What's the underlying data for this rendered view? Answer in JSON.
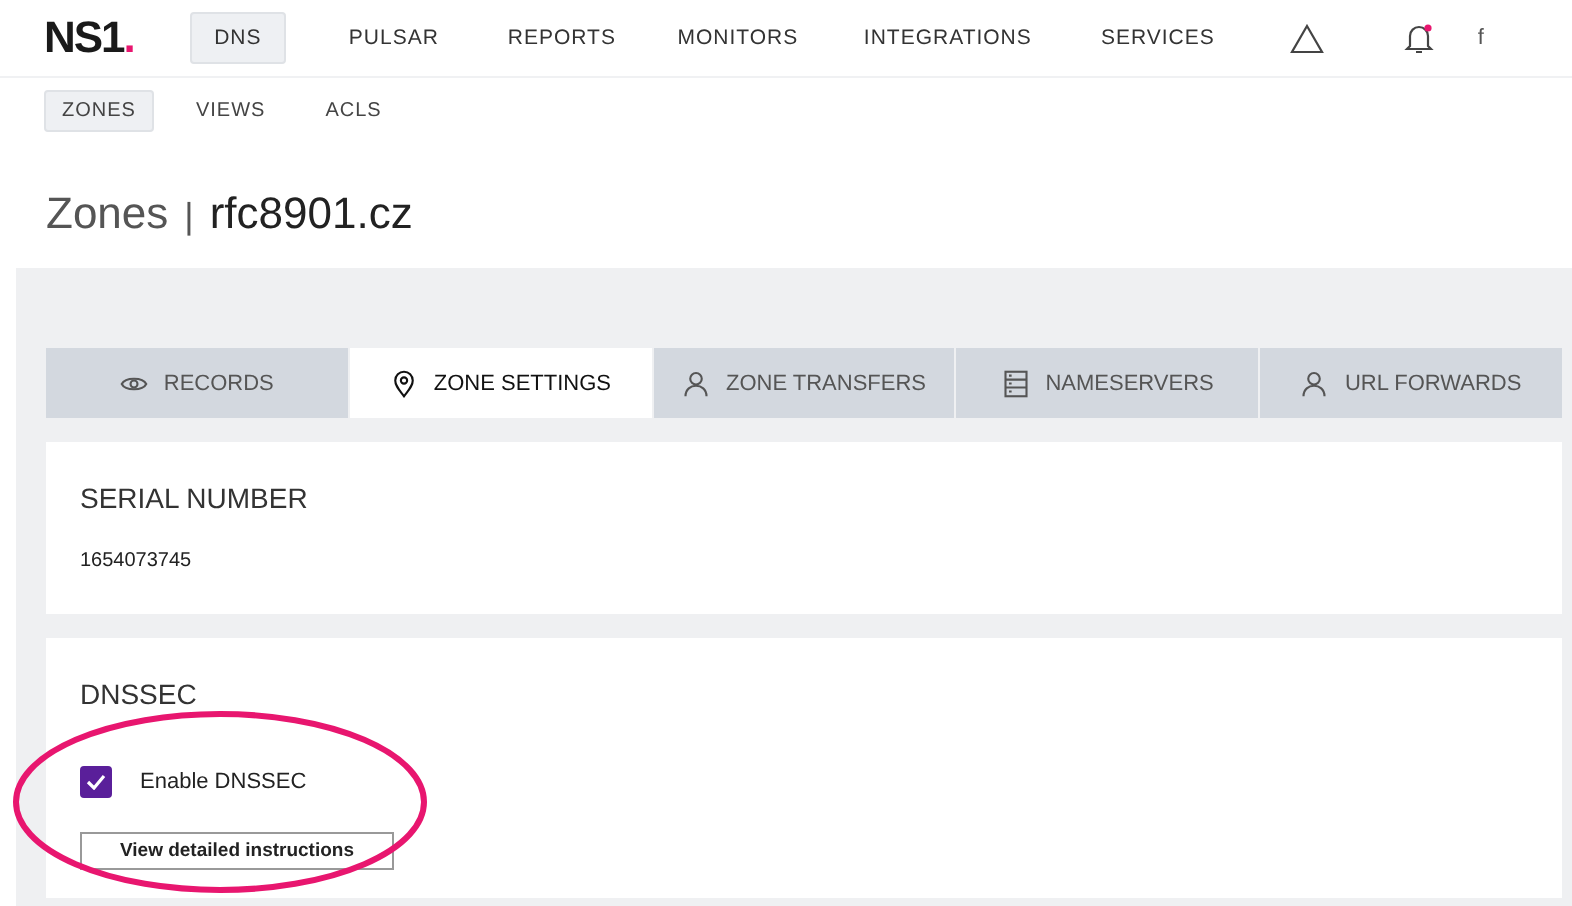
{
  "brand": {
    "logo": "NS1",
    "dot": "."
  },
  "nav": [
    {
      "label": "DNS",
      "selected": true
    },
    {
      "label": "PULSAR",
      "selected": false
    },
    {
      "label": "REPORTS",
      "selected": false
    },
    {
      "label": "MONITORS",
      "selected": false
    },
    {
      "label": "INTEGRATIONS",
      "selected": false
    },
    {
      "label": "SERVICES",
      "selected": false
    }
  ],
  "notifications": {
    "unread": true
  },
  "user": {
    "label": "f"
  },
  "subnav": [
    {
      "label": "ZONES",
      "selected": true
    },
    {
      "label": "VIEWS",
      "selected": false
    },
    {
      "label": "ACLS",
      "selected": false
    }
  ],
  "page_title": {
    "section": "Zones",
    "separator": "|",
    "zone": "rfc8901.cz"
  },
  "tabs": [
    {
      "label": "RECORDS",
      "kind": "eye",
      "selected": false
    },
    {
      "label": "ZONE SETTINGS",
      "kind": "pin",
      "selected": true
    },
    {
      "label": "ZONE TRANSFERS",
      "kind": "person",
      "selected": false
    },
    {
      "label": "NAMESERVERS",
      "kind": "server",
      "selected": false
    },
    {
      "label": "URL FORWARDS",
      "kind": "person",
      "selected": false
    }
  ],
  "serial": {
    "heading": "SERIAL NUMBER",
    "value": "1654073745"
  },
  "dnssec": {
    "heading": "DNSSEC",
    "checkbox": {
      "label": "Enable DNSSEC",
      "checked": true
    },
    "button": "View detailed instructions"
  },
  "annotations": [
    {
      "kind": "ellipse",
      "color": "#e8166f"
    }
  ]
}
